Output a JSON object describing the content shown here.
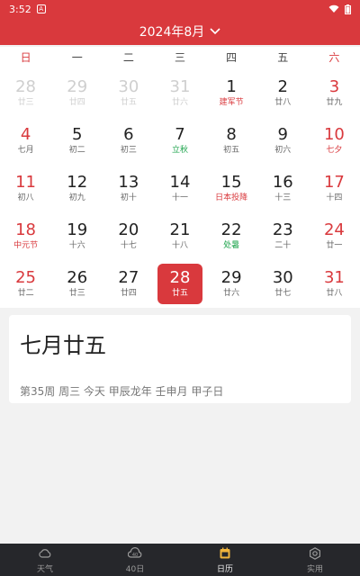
{
  "status_bar": {
    "time": "3:52",
    "notification_glyph": "A"
  },
  "header": {
    "title": "2024年8月"
  },
  "weekdays": [
    "日",
    "一",
    "二",
    "三",
    "四",
    "五",
    "六"
  ],
  "days": [
    {
      "num": "28",
      "lunar": "廿三",
      "other": true
    },
    {
      "num": "29",
      "lunar": "廿四",
      "other": true
    },
    {
      "num": "30",
      "lunar": "廿五",
      "other": true
    },
    {
      "num": "31",
      "lunar": "廿六",
      "other": true
    },
    {
      "num": "1",
      "lunar": "建军节",
      "lunar_color": "red"
    },
    {
      "num": "2",
      "lunar": "廿八"
    },
    {
      "num": "3",
      "lunar": "廿九"
    },
    {
      "num": "4",
      "lunar": "七月"
    },
    {
      "num": "5",
      "lunar": "初二"
    },
    {
      "num": "6",
      "lunar": "初三"
    },
    {
      "num": "7",
      "lunar": "立秋",
      "lunar_color": "green"
    },
    {
      "num": "8",
      "lunar": "初五"
    },
    {
      "num": "9",
      "lunar": "初六"
    },
    {
      "num": "10",
      "lunar": "七夕",
      "lunar_color": "red"
    },
    {
      "num": "11",
      "lunar": "初八"
    },
    {
      "num": "12",
      "lunar": "初九"
    },
    {
      "num": "13",
      "lunar": "初十"
    },
    {
      "num": "14",
      "lunar": "十一"
    },
    {
      "num": "15",
      "lunar": "日本投降",
      "lunar_color": "red"
    },
    {
      "num": "16",
      "lunar": "十三"
    },
    {
      "num": "17",
      "lunar": "十四"
    },
    {
      "num": "18",
      "lunar": "中元节",
      "lunar_color": "red"
    },
    {
      "num": "19",
      "lunar": "十六"
    },
    {
      "num": "20",
      "lunar": "十七"
    },
    {
      "num": "21",
      "lunar": "十八"
    },
    {
      "num": "22",
      "lunar": "处暑",
      "lunar_color": "green"
    },
    {
      "num": "23",
      "lunar": "二十"
    },
    {
      "num": "24",
      "lunar": "廿一"
    },
    {
      "num": "25",
      "lunar": "廿二"
    },
    {
      "num": "26",
      "lunar": "廿三"
    },
    {
      "num": "27",
      "lunar": "廿四"
    },
    {
      "num": "28",
      "lunar": "廿五",
      "selected": true
    },
    {
      "num": "29",
      "lunar": "廿六"
    },
    {
      "num": "30",
      "lunar": "廿七"
    },
    {
      "num": "31",
      "lunar": "廿八"
    }
  ],
  "info": {
    "lunar_date": "七月廿五",
    "detail": "第35周 周三 今天 甲辰龙年 壬申月 甲子日"
  },
  "tabs": [
    {
      "label": "天气",
      "icon": "cloud-icon"
    },
    {
      "label": "40日",
      "icon": "forecast-40-icon"
    },
    {
      "label": "日历",
      "icon": "calendar-icon",
      "active": true
    },
    {
      "label": "实用",
      "icon": "gear-icon"
    }
  ],
  "colors": {
    "accent": "#d9393d",
    "tabbar": "#26272b",
    "festival": "#d9393d",
    "solar_term": "#1aa34a"
  }
}
